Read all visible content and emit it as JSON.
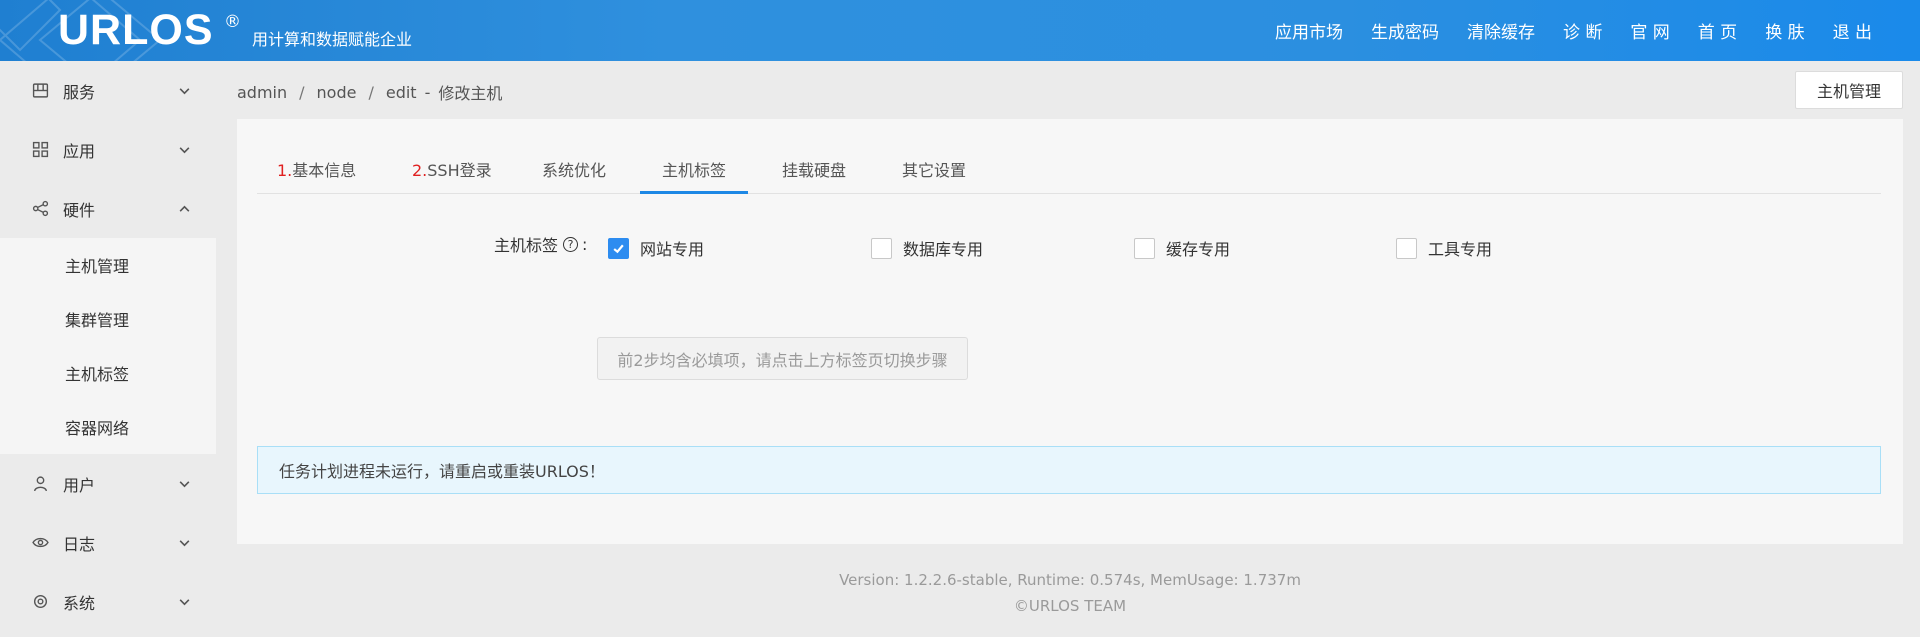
{
  "header": {
    "logo": "URLOS",
    "logo_mark": "®",
    "slogan": "用计算和数据赋能企业",
    "nav": [
      "应用市场",
      "生成密码",
      "清除缓存",
      "诊 断",
      "官 网",
      "首 页",
      "换 肤",
      "退 出"
    ]
  },
  "sidebar": {
    "items": [
      {
        "label": "服务",
        "icon": "service-icon"
      },
      {
        "label": "应用",
        "icon": "apps-grid-icon"
      },
      {
        "label": "硬件",
        "icon": "share-nodes-icon",
        "expanded": true
      },
      {
        "label": "用户",
        "icon": "user-icon"
      },
      {
        "label": "日志",
        "icon": "eye-icon"
      },
      {
        "label": "系统",
        "icon": "gear-icon"
      }
    ],
    "sub_items": [
      "主机管理",
      "集群管理",
      "主机标签",
      "容器网络"
    ]
  },
  "breadcrumb": {
    "parts": [
      "admin",
      "node",
      "edit"
    ],
    "sep": "/",
    "dash": "-",
    "current": "修改主机"
  },
  "host_button": "主机管理",
  "tabs": [
    {
      "num": "1.",
      "label": "基本信息"
    },
    {
      "num": "2.",
      "label": "SSH登录"
    },
    {
      "num": "",
      "label": "系统优化"
    },
    {
      "num": "",
      "label": "主机标签",
      "active": true
    },
    {
      "num": "",
      "label": "挂载硬盘"
    },
    {
      "num": "",
      "label": "其它设置"
    }
  ],
  "form": {
    "label": "主机标签",
    "help": "?",
    "colon": ":",
    "options": [
      {
        "label": "网站专用",
        "checked": true
      },
      {
        "label": "数据库专用",
        "checked": false
      },
      {
        "label": "缓存专用",
        "checked": false
      },
      {
        "label": "工具专用",
        "checked": false
      }
    ]
  },
  "disabled_button": "前2步均含必填项，请点击上方标签页切换步骤",
  "alert": "任务计划进程未运行，请重启或重装URLOS！",
  "footer": {
    "line1": "Version: 1.2.2.6-stable,    Runtime: 0.574s,    MemUsage: 1.737m",
    "line2": "©URLOS TEAM"
  },
  "colors": {
    "accent": "#2d8cf0",
    "header": "#2f90de",
    "required": "#e02020"
  }
}
